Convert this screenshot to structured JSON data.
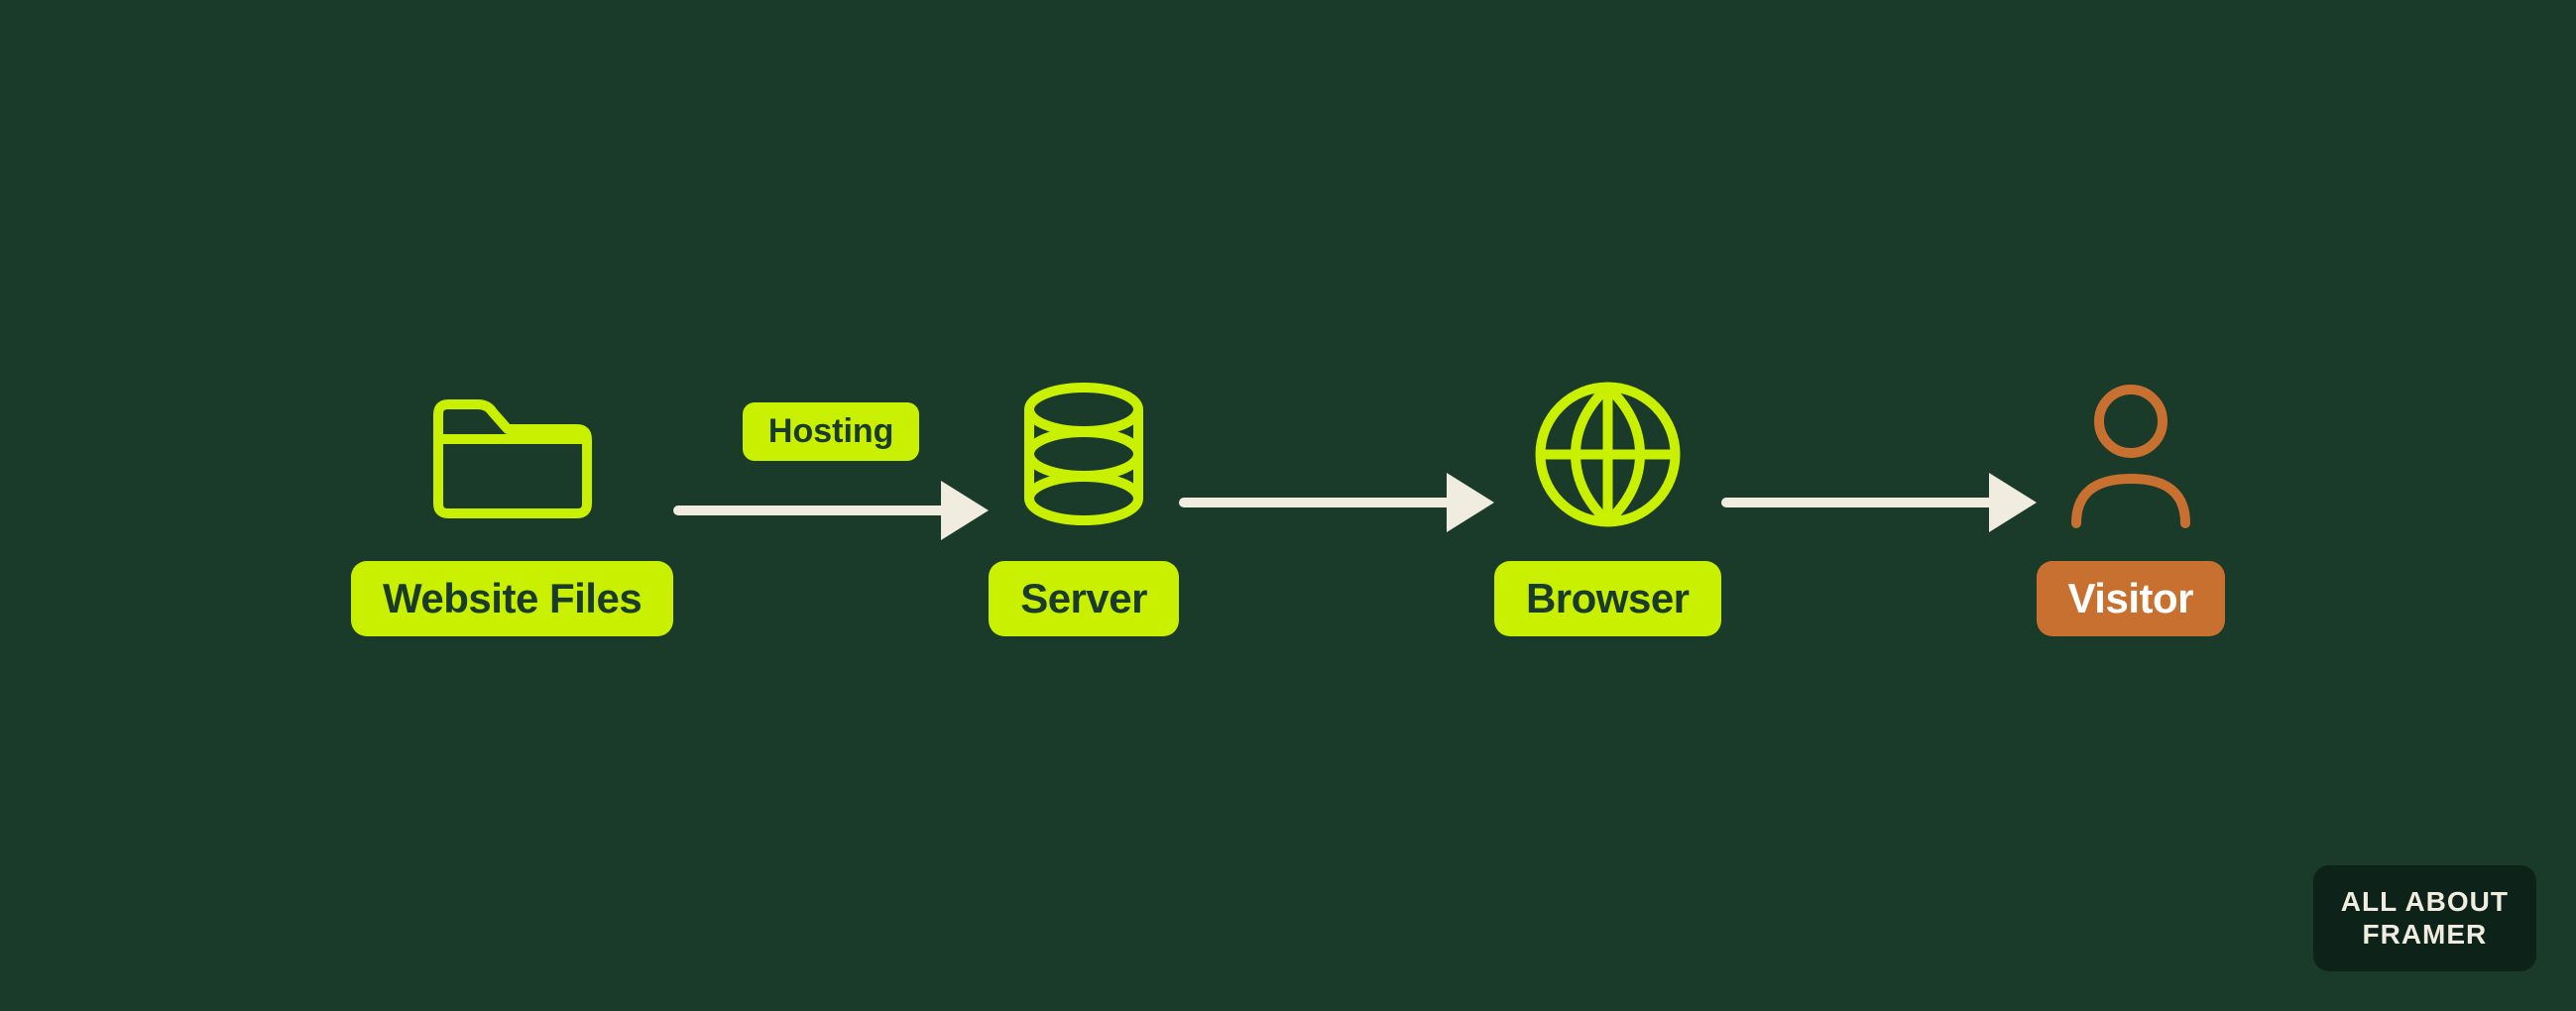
{
  "colors": {
    "background": "#1a3a2a",
    "lime": "#c8f000",
    "arrow": "#f0f0e0",
    "orange": "#c87030",
    "text_dark": "#1a3a2a",
    "text_light": "#ffffff",
    "branding_bg": "#0d2218",
    "branding_text": "#f0ede0"
  },
  "nodes": [
    {
      "id": "website-files",
      "label": "Website Files",
      "label_type": "lime",
      "icon": "folder"
    },
    {
      "id": "server",
      "label": "Server",
      "label_type": "lime",
      "icon": "database"
    },
    {
      "id": "browser",
      "label": "Browser",
      "label_type": "lime",
      "icon": "globe"
    },
    {
      "id": "visitor",
      "label": "Visitor",
      "label_type": "orange",
      "icon": "person"
    }
  ],
  "arrows": [
    {
      "id": "arrow-1",
      "has_label": true,
      "label": "Hosting"
    },
    {
      "id": "arrow-2",
      "has_label": false,
      "label": ""
    },
    {
      "id": "arrow-3",
      "has_label": false,
      "label": ""
    }
  ],
  "branding": {
    "line1": "ALL ABOUT",
    "line2": "FRAMER"
  }
}
